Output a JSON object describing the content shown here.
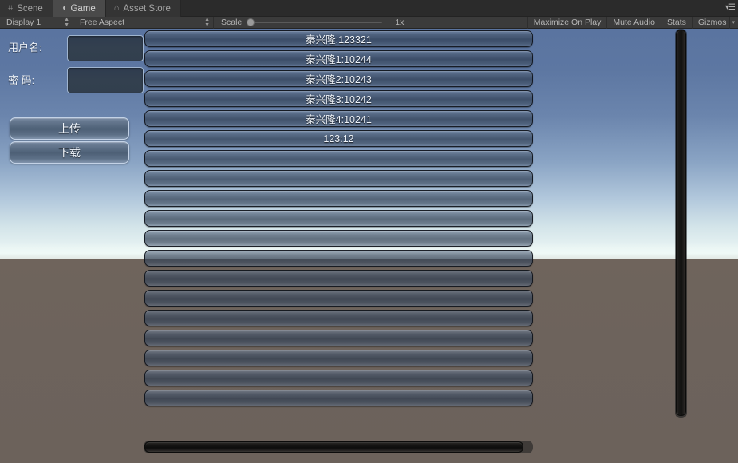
{
  "editor": {
    "tabs": [
      {
        "label": "Scene",
        "icon": "grid-icon",
        "icon_glyph": "⌗",
        "active": false
      },
      {
        "label": "Game",
        "icon": "gamepad-icon",
        "icon_glyph": "◖",
        "active": true
      },
      {
        "label": "Asset Store",
        "icon": "store-icon",
        "icon_glyph": "⌂",
        "active": false
      }
    ],
    "tab_menu_glyph": "▾☰",
    "toolbar": {
      "display": "Display 1",
      "aspect": "Free Aspect",
      "scale_label": "Scale",
      "scale_value": "1x",
      "maximize_on_play": "Maximize On Play",
      "mute_audio": "Mute Audio",
      "stats": "Stats",
      "gizmos": "Gizmos",
      "gizmos_caret": "▾"
    }
  },
  "game": {
    "colors": {
      "sky_top": "#5a74a0",
      "sky_horizon": "#eef7f4",
      "ground": "#6d635c",
      "panel_row": "#3a4a60",
      "accent_border": "#c3d2e6",
      "input_fill": "#313e4e"
    },
    "form": {
      "username_label": "用户名:",
      "username_value": "",
      "username_placeholder": "",
      "password_label": "密 码:",
      "password_value": "",
      "password_placeholder": "",
      "upload_button": "上传",
      "download_button": "下载"
    },
    "list": {
      "rows": [
        {
          "text": "秦兴隆:123321"
        },
        {
          "text": "秦兴隆1:10244"
        },
        {
          "text": "秦兴隆2:10243"
        },
        {
          "text": "秦兴隆3:10242"
        },
        {
          "text": "秦兴隆4:10241"
        },
        {
          "text": "123:12"
        },
        {
          "text": ""
        },
        {
          "text": ""
        },
        {
          "text": ""
        },
        {
          "text": ""
        },
        {
          "text": ""
        },
        {
          "text": ""
        },
        {
          "text": ""
        },
        {
          "text": ""
        },
        {
          "text": ""
        },
        {
          "text": ""
        },
        {
          "text": ""
        },
        {
          "text": ""
        },
        {
          "text": ""
        }
      ]
    }
  }
}
